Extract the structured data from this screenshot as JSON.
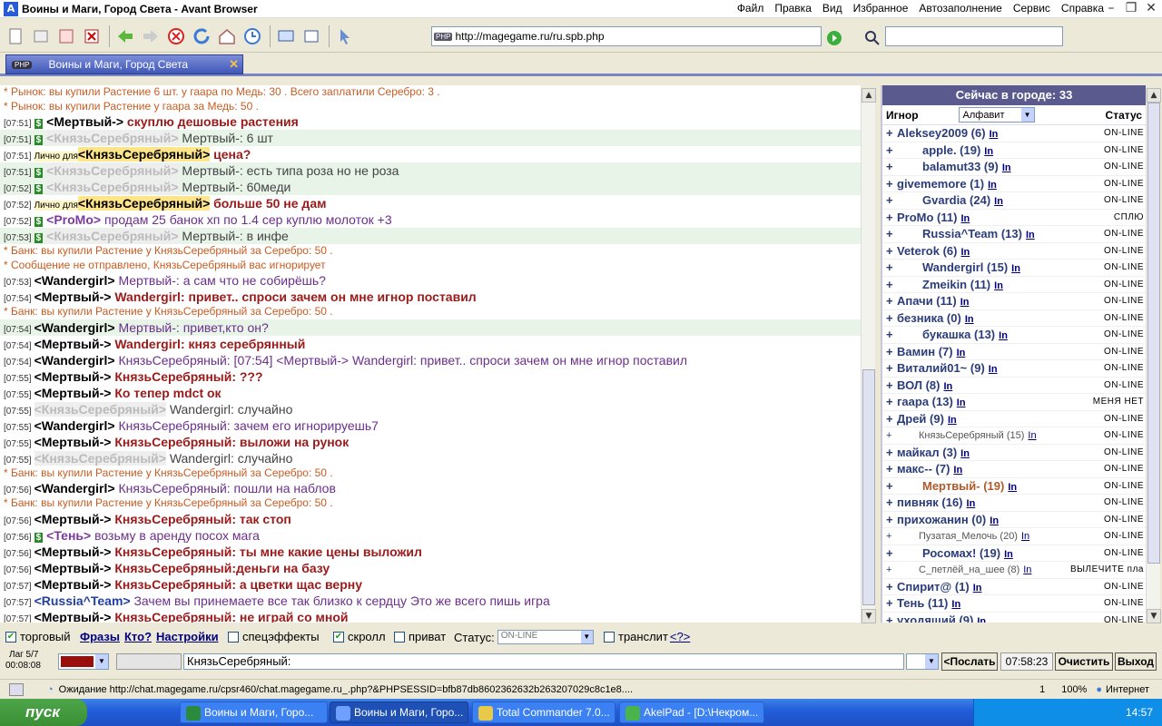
{
  "window": {
    "title": "Воины и Маги, Город Света - Avant Browser"
  },
  "menu": [
    "Файл",
    "Правка",
    "Вид",
    "Избранное",
    "Автозаполнение",
    "Сервис",
    "Справка"
  ],
  "address": {
    "url": "http://magegame.ru/ru.spb.php"
  },
  "tab": {
    "label": "Воины и Маги, Город Света"
  },
  "chat": {
    "lines": [
      {
        "type": "sys",
        "text": "* Рынок: вы купили Растение 6 шт. у гаара по Медь: 30 . Всего заплатили Серебро: 3 ."
      },
      {
        "type": "sys",
        "text": "* Рынок: вы купили Растение у гаара за Медь: 50 ."
      },
      {
        "type": "msg",
        "ts": "[07:51]",
        "dollar": "$",
        "nick": "<Мертвый->",
        "nickStyle": "",
        "msg": "скуплю дешовые растения",
        "msgStyle": "red"
      },
      {
        "type": "msg",
        "ts": "[07:51]",
        "dollar": "$",
        "nick": "<КнязьСеребряный>",
        "nickStyle": "grey",
        "msg": "Мертвый-: 6 шт",
        "msgStyle": "grey",
        "hl": true
      },
      {
        "type": "priv",
        "ts": "[07:51]",
        "priv": "Лично для",
        "nick": "<КнязьСеребряный>",
        "msg": "цена?",
        "msgStyle": "red"
      },
      {
        "type": "msg",
        "ts": "[07:51]",
        "dollar": "$",
        "nick": "<КнязьСеребряный>",
        "nickStyle": "grey",
        "msg": "Мертвый-: есть типа роза но не роза",
        "msgStyle": "grey",
        "hl": true
      },
      {
        "type": "msg",
        "ts": "[07:52]",
        "dollar": "$",
        "nick": "<КнязьСеребряный>",
        "nickStyle": "grey",
        "msg": "Мертвый-: 60меди",
        "msgStyle": "grey",
        "hl": true
      },
      {
        "type": "priv",
        "ts": "[07:52]",
        "priv": "Лично для",
        "nick": "<КнязьСеребряный>",
        "msg": "больше 50 не дам",
        "msgStyle": "red"
      },
      {
        "type": "msg",
        "ts": "[07:52]",
        "dollar": "$",
        "nick": "<ProMo>",
        "nickStyle": "purple",
        "msg": "продам 25 банок хп по 1.4 сер куплю молоток +3",
        "msgStyle": "purple"
      },
      {
        "type": "msg",
        "ts": "[07:53]",
        "dollar": "$",
        "nick": "<КнязьСеребряный>",
        "nickStyle": "grey",
        "msg": "Мертвый-: в инфе",
        "msgStyle": "grey",
        "hl": true
      },
      {
        "type": "sys",
        "text": "* Банк: вы купили Растение у КнязьСеребряный за Серебро: 50 ."
      },
      {
        "type": "sys",
        "text": "* Сообщение не отправлено, КнязьСеребряный вас игнорирует"
      },
      {
        "type": "msg",
        "ts": "[07:53]",
        "dollar": "",
        "nick": "<Wandergirl>",
        "nickStyle": "",
        "msg": "Мертвый-: а сам что не собирёшь?",
        "msgStyle": "purple"
      },
      {
        "type": "msg",
        "ts": "[07:54]",
        "dollar": "",
        "nick": "<Мертвый->",
        "nickStyle": "",
        "msg": "Wandergirl: привет.. спроси зачем он мне игнор поставил",
        "msgStyle": "red"
      },
      {
        "type": "sys",
        "text": "* Банк: вы купили Растение у КнязьСеребряный за Серебро: 50 ."
      },
      {
        "type": "msg",
        "ts": "[07:54]",
        "dollar": "",
        "nick": "<Wandergirl>",
        "nickStyle": "",
        "msg": "Мертвый-: привет,кто он?",
        "msgStyle": "purple",
        "hl": true
      },
      {
        "type": "msg",
        "ts": "[07:54]",
        "dollar": "",
        "nick": "<Мертвый->",
        "nickStyle": "",
        "msg": "Wandergirl: княз серебрянный",
        "msgStyle": "red"
      },
      {
        "type": "msg",
        "ts": "[07:54]",
        "dollar": "",
        "nick": "<Wandergirl>",
        "nickStyle": "",
        "msg": "КнязьСеребряный: [07:54] <Мертвый-> Wandergirl: привет.. спроси зачем он мне игнор поставил",
        "msgStyle": "purple"
      },
      {
        "type": "msg",
        "ts": "[07:55]",
        "dollar": "",
        "nick": "<Мертвый->",
        "nickStyle": "",
        "msg": "КнязьСеребряный: ???",
        "msgStyle": "red"
      },
      {
        "type": "msg",
        "ts": "[07:55]",
        "dollar": "",
        "nick": "<Мертвый->",
        "nickStyle": "",
        "msg": "Ко тепер mdct ок",
        "msgStyle": "red"
      },
      {
        "type": "msg",
        "ts": "[07:55]",
        "dollar": "",
        "nick": "<КнязьСеребряный>",
        "nickStyle": "grey",
        "msg": "Wandergirl: случайно",
        "msgStyle": "grey"
      },
      {
        "type": "msg",
        "ts": "[07:55]",
        "dollar": "",
        "nick": "<Wandergirl>",
        "nickStyle": "",
        "msg": "КнязьСеребряный: зачем его игнорируешь7",
        "msgStyle": "purple"
      },
      {
        "type": "msg",
        "ts": "[07:55]",
        "dollar": "",
        "nick": "<Мертвый->",
        "nickStyle": "",
        "msg": "КнязьСеребряный: выложи на рунок",
        "msgStyle": "red"
      },
      {
        "type": "msg",
        "ts": "[07:55]",
        "dollar": "",
        "nick": "<КнязьСеребряный>",
        "nickStyle": "grey",
        "msg": "Wandergirl: случайно",
        "msgStyle": "grey"
      },
      {
        "type": "sys",
        "text": "* Банк: вы купили Растение у КнязьСеребряный за Серебро: 50 ."
      },
      {
        "type": "msg",
        "ts": "[07:56]",
        "dollar": "",
        "nick": "<Wandergirl>",
        "nickStyle": "",
        "msg": "КнязьСеребряный: пошли на наблов",
        "msgStyle": "purple"
      },
      {
        "type": "sys",
        "text": "* Банк: вы купили Растение у КнязьСеребряный за Серебро: 50 ."
      },
      {
        "type": "msg",
        "ts": "[07:56]",
        "dollar": "",
        "nick": "<Мертвый->",
        "nickStyle": "",
        "msg": "КнязьСеребряный: так стоп",
        "msgStyle": "red"
      },
      {
        "type": "msg",
        "ts": "[07:56]",
        "dollar": "$",
        "nick": "<Тень>",
        "nickStyle": "purple",
        "msg": "возьму в аренду посох мага",
        "msgStyle": "purple"
      },
      {
        "type": "msg",
        "ts": "[07:56]",
        "dollar": "",
        "nick": "<Мертвый->",
        "nickStyle": "",
        "msg": "КнязьСеребряный: ты мне какие цены выложил",
        "msgStyle": "red"
      },
      {
        "type": "msg",
        "ts": "[07:56]",
        "dollar": "",
        "nick": "<Мертвый->",
        "nickStyle": "",
        "msg": "КнязьСеребряный:деньги на базу",
        "msgStyle": "red"
      },
      {
        "type": "msg",
        "ts": "[07:57]",
        "dollar": "",
        "nick": "<Мертвый->",
        "nickStyle": "",
        "msg": "КнязьСеребряный: а цветки щас верну",
        "msgStyle": "red"
      },
      {
        "type": "msg",
        "ts": "[07:57]",
        "dollar": "",
        "nick": "<Russia^Team>",
        "nickStyle": "blue",
        "msg": "Зачем вы принемаете все так близко к сердцу     Это же всего пишь игра",
        "msgStyle": "purple"
      },
      {
        "type": "msg",
        "ts": "[07:57]",
        "dollar": "",
        "nick": "<Мертвый->",
        "nickStyle": "",
        "msg": "КнязьСеребряный: не играй со мной",
        "msgStyle": "red"
      }
    ]
  },
  "sidebar": {
    "header": "Сейчас в городе: 33",
    "col_ignore": "Игнор",
    "sort_value": "Алфавит",
    "col_status": "Статус",
    "users": [
      {
        "name": "Aleksey2009 (6)",
        "st": "ON-LINE",
        "ind": false
      },
      {
        "name": "apple. (19)",
        "st": "ON-LINE",
        "ind": true
      },
      {
        "name": "balamut33 (9)",
        "st": "ON-LINE",
        "ind": true
      },
      {
        "name": "givememore (1)",
        "st": "ON-LINE",
        "ind": false
      },
      {
        "name": "Gvardia (24)",
        "st": "ON-LINE",
        "ind": true
      },
      {
        "name": "ProMo (11)",
        "st": "СПЛЮ",
        "ind": false
      },
      {
        "name": "Russia^Team (13)",
        "st": "ON-LINE",
        "ind": true
      },
      {
        "name": "Veterok (6)",
        "st": "ON-LINE",
        "ind": false
      },
      {
        "name": "Wandergirl (15)",
        "st": "ON-LINE",
        "ind": true
      },
      {
        "name": "Zmeikin (11)",
        "st": "ON-LINE",
        "ind": true
      },
      {
        "name": "Апачи (11)",
        "st": "ON-LINE",
        "ind": false
      },
      {
        "name": "безника (0)",
        "st": "ON-LINE",
        "ind": false
      },
      {
        "name": "букашка (13)",
        "st": "ON-LINE",
        "ind": true
      },
      {
        "name": "Вамин (7)",
        "st": "ON-LINE",
        "ind": false
      },
      {
        "name": "Виталий01~ (9)",
        "st": "ON-LINE",
        "ind": false
      },
      {
        "name": "ВОЛ (8)",
        "st": "ON-LINE",
        "ind": false
      },
      {
        "name": "гаара (13)",
        "st": "МЕНЯ НЕТ",
        "ind": false
      },
      {
        "name": "Дрей (9)",
        "st": "ON-LINE",
        "ind": false
      },
      {
        "name": "КнязьСеребряный (15)",
        "st": "ON-LINE",
        "ind": false,
        "small": true
      },
      {
        "name": "майкал (3)",
        "st": "ON-LINE",
        "ind": false
      },
      {
        "name": "макс-- (7)",
        "st": "ON-LINE",
        "ind": false
      },
      {
        "name": "Мертвый- (19)",
        "st": "ON-LINE",
        "ind": true,
        "me": true
      },
      {
        "name": "пивняк (16)",
        "st": "ON-LINE",
        "ind": false
      },
      {
        "name": "прихожанин (0)",
        "st": "ON-LINE",
        "ind": false
      },
      {
        "name": "Пузатая_Мелочь (20)",
        "st": "ON-LINE",
        "ind": false,
        "small": true
      },
      {
        "name": "Росомах! (19)",
        "st": "ON-LINE",
        "ind": true
      },
      {
        "name": "С_петлёй_на_шее (8)",
        "st": "ВЫЛЕЧИТЕ пла",
        "ind": false,
        "small": true
      },
      {
        "name": "Спирит@ (1)",
        "st": "ON-LINE",
        "ind": false
      },
      {
        "name": "Тень (11)",
        "st": "ON-LINE",
        "ind": false
      },
      {
        "name": "уходящий (9)",
        "st": "ON-LINE",
        "ind": false
      }
    ]
  },
  "bottom": {
    "trade": "торговый",
    "phrases": "Фразы",
    "who": "Кто?",
    "settings": "Настройки",
    "effects": "спецэффекты",
    "scroll": "скролл",
    "private": "приват",
    "status_label": "Статус:",
    "status_value": "ON-LINE",
    "translit": "транслит",
    "translit_help": "<?>",
    "lag": "Лаг 5/7",
    "timer": "00:08:08",
    "input_value": "КнязьСеребряный:",
    "send": "<Послать",
    "clock": "07:58:23",
    "clear": "Очистить",
    "exit": "Выход"
  },
  "statusbar": {
    "text": "Ожидание http://chat.magegame.ru/cpsr460/chat.magegame.ru_.php?&PHPSESSID=bfb87db8602362632b263207029c8c1e8....",
    "tabs": "1",
    "zoom": "100%",
    "zone": "Интернет"
  },
  "taskbar": {
    "start": "пуск",
    "tasks": [
      "Воины и Маги, Горо...",
      "Воины и Маги, Горо...",
      "Total Commander 7.0...",
      "AkelPad - [D:\\Некром..."
    ],
    "time": "14:57"
  }
}
